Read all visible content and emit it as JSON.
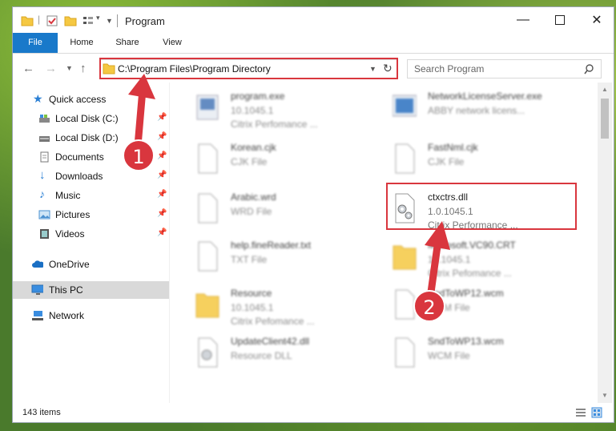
{
  "window": {
    "title": "Program"
  },
  "ribbon": {
    "tabs": [
      "File",
      "Home",
      "Share",
      "View"
    ]
  },
  "address": {
    "path": "C:\\Program Files\\Program Directory"
  },
  "search": {
    "placeholder": "Search Program"
  },
  "nav": {
    "items": [
      {
        "label": "Quick access",
        "icon": "star-icon"
      },
      {
        "label": "Local Disk (C:)",
        "icon": "drive-icon"
      },
      {
        "label": "Local Disk (D:)",
        "icon": "drive-icon"
      },
      {
        "label": "Documents",
        "icon": "documents-icon"
      },
      {
        "label": "Downloads",
        "icon": "download-icon"
      },
      {
        "label": "Music",
        "icon": "music-icon"
      },
      {
        "label": "Pictures",
        "icon": "pictures-icon"
      },
      {
        "label": "Videos",
        "icon": "videos-icon"
      },
      {
        "label": "OneDrive",
        "icon": "cloud-icon"
      },
      {
        "label": "This PC",
        "icon": "computer-icon"
      },
      {
        "label": "Network",
        "icon": "network-icon"
      }
    ]
  },
  "files": [
    {
      "name": "program.exe",
      "line2": "10.1045.1",
      "line3": "Citrix Perfomance ..."
    },
    {
      "name": "NetworkLicenseServer.exe",
      "line2": "ABBY network licens...",
      "line3": ""
    },
    {
      "name": "Korean.cjk",
      "line2": "CJK File",
      "line3": ""
    },
    {
      "name": "FastNml.cjk",
      "line2": "CJK File",
      "line3": ""
    },
    {
      "name": "Arabic.wrd",
      "line2": "WRD File",
      "line3": ""
    },
    {
      "name": "ctxctrs.dll",
      "line2": "1.0.1045.1",
      "line3": "Citrix Performance ..."
    },
    {
      "name": "help.fineReader.txt",
      "line2": "TXT File",
      "line3": ""
    },
    {
      "name": "Microsoft.VC90.CRT",
      "line2": "10.1045.1",
      "line3": "Citrix Pefomance ..."
    },
    {
      "name": "Resource",
      "line2": "10.1045.1",
      "line3": "Citrix Pefomance ..."
    },
    {
      "name": "SndToWP12.wcm",
      "line2": "WCM File",
      "line3": ""
    },
    {
      "name": "UpdateClient42.dll",
      "line2": "Resource DLL",
      "line3": ""
    },
    {
      "name": "SndToWP13.wcm",
      "line2": "WCM File",
      "line3": ""
    }
  ],
  "status": {
    "items_count": "143 items"
  },
  "annotations": {
    "step1": "1",
    "step2": "2"
  },
  "colors": {
    "accent": "#1979ca",
    "highlight": "#d9363e"
  }
}
